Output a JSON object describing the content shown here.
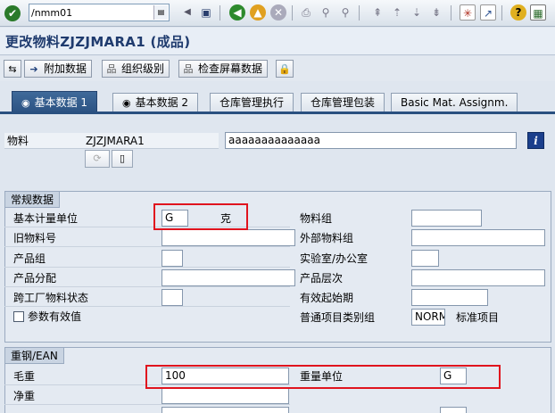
{
  "systembar": {
    "command": "/nmm01",
    "icons": [
      "enter-icon",
      "back-arrow-icon",
      "save-icon",
      "back-icon",
      "exit-icon",
      "cancel-icon",
      "print-icon",
      "find-icon",
      "find-next-icon",
      "first-page-icon",
      "prev-page-icon",
      "next-page-icon",
      "last-page-icon",
      "new-session-icon",
      "shortcut-icon",
      "help-icon",
      "customize-layout-icon"
    ]
  },
  "title": "更改物料ZJZJMARA1 (成品)",
  "appbar": {
    "buttons": [
      {
        "icon": "⇆",
        "label": ""
      },
      {
        "icon": "➔",
        "label": "附加数据"
      },
      {
        "icon": "品",
        "label": "组织级别"
      },
      {
        "icon": "品",
        "label": "检查屏幕数据"
      },
      {
        "icon": "🔒",
        "label": ""
      }
    ]
  },
  "tabs": [
    {
      "label": "基本数据 1",
      "active": true
    },
    {
      "label": "基本数据 2",
      "active": false
    },
    {
      "label": "仓库管理执行",
      "active": false
    },
    {
      "label": "仓库管理包装",
      "active": false
    },
    {
      "label": "Basic Mat. Assignm.",
      "active": false
    }
  ],
  "header": {
    "material_label": "物料",
    "material_value": "ZJZJMARA1",
    "description": "aaaaaaaaaaaaaa"
  },
  "general": {
    "title": "常规数据",
    "base_uom_label": "基本计量单位",
    "base_uom_value": "G",
    "base_uom_text": "克",
    "material_group_label": "物料组",
    "material_group_value": "",
    "old_material_label": "旧物料号",
    "old_material_value": "",
    "ext_material_group_label": "外部物料组",
    "ext_material_group_value": "",
    "division_label": "产品组",
    "division_value": "",
    "lab_office_label": "实验室/办公室",
    "lab_office_value": "",
    "prod_allocation_label": "产品分配",
    "prod_allocation_value": "",
    "prod_hierarchy_label": "产品层次",
    "prod_hierarchy_value": "",
    "cross_plant_status_label": "跨工厂物料状态",
    "cross_plant_status_value": "",
    "valid_from_label": "有效起始期",
    "valid_from_value": "",
    "param_effective_label": "参数有效值",
    "item_category_label": "普通项目类别组",
    "item_category_value": "NORM",
    "item_category_text": "标准项目"
  },
  "dimensions": {
    "title": "重钢/EAN",
    "gross_weight_label": "毛重",
    "gross_weight_value": "100",
    "weight_unit_label": "重量单位",
    "weight_unit_value": "G",
    "net_weight_label": "净重",
    "net_weight_value": ""
  }
}
